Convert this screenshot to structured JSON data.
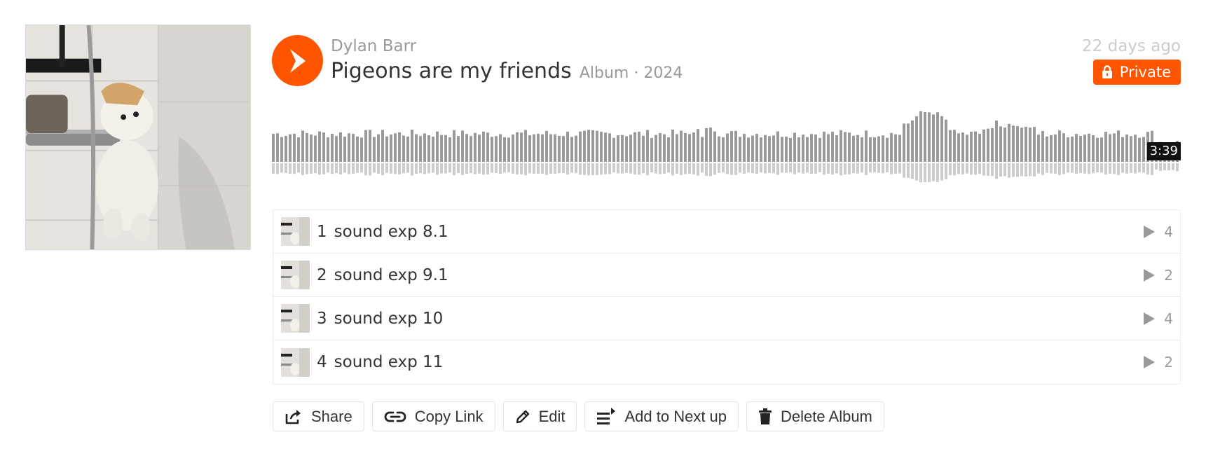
{
  "album": {
    "artist": "Dylan Barr",
    "title": "Pigeons are my friends",
    "meta": "Album · 2024",
    "posted": "22 days ago",
    "privacy_label": "Private",
    "duration": "3:39",
    "artwork_icon": "album-artwork-image"
  },
  "tracks": [
    {
      "num": "1",
      "title": "sound exp 8.1",
      "plays": "4"
    },
    {
      "num": "2",
      "title": "sound exp 9.1",
      "plays": "2"
    },
    {
      "num": "3",
      "title": "sound exp 10",
      "plays": "4"
    },
    {
      "num": "4",
      "title": "sound exp 11",
      "plays": "2"
    }
  ],
  "actions": {
    "share": "Share",
    "copy_link": "Copy Link",
    "edit": "Edit",
    "add_next": "Add to Next up",
    "delete": "Delete Album"
  },
  "colors": {
    "accent": "#ff5500",
    "waveform_top": "#999999",
    "waveform_bottom": "#cccccc"
  }
}
